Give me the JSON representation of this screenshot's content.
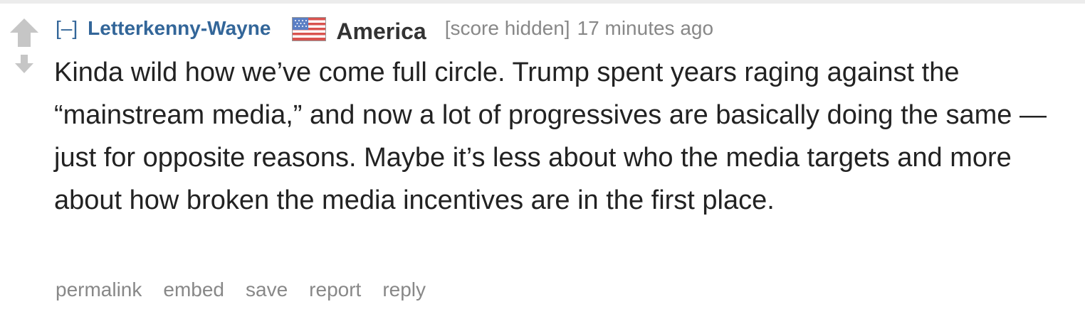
{
  "comment": {
    "expand_label": "[–]",
    "author": "Letterkenny-Wayne",
    "flair": {
      "icon": "us-flag-icon",
      "text": "America"
    },
    "score": "[score hidden]",
    "time": "17 minutes ago",
    "body": "Kinda wild how we’ve come full circle. Trump spent years raging against the “mainstream media,” and now a lot of progressives are basically doing the same — just for opposite reasons. Maybe it’s less about who the media targets and more about how broken the media incentives are in the first place."
  },
  "actions": {
    "permalink": "permalink",
    "embed": "embed",
    "save": "save",
    "report": "report",
    "reply": "reply"
  },
  "colors": {
    "author": "#336699",
    "meta": "#888888",
    "body": "#222222",
    "arrow": "#c6c6c6"
  }
}
